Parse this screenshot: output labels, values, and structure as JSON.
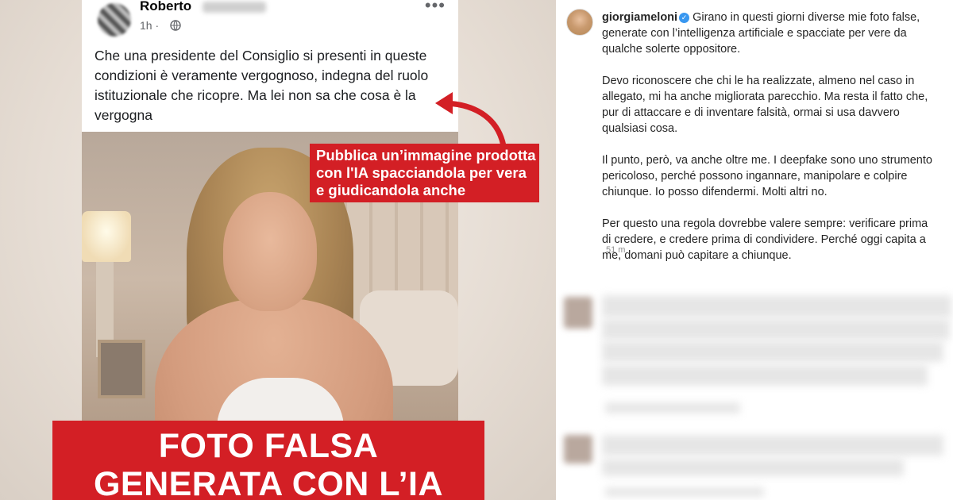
{
  "facebook_post": {
    "author": "Roberto",
    "time": "1h ·",
    "text": "Che una presidente del Consiglio  si presenti in queste condizioni è veramente vergognoso, indegna del ruolo istituzionale che ricopre. Ma lei non sa che cosa è la vergogna"
  },
  "callout": {
    "text": "Pubblica un’immagine prodotta con l'IA spacciandola per vera e giudicandola anche"
  },
  "banner": {
    "line1": "FOTO FALSA",
    "line2": "GENERATA CON L’IA"
  },
  "instagram": {
    "username": "giorgiameloni",
    "paragraphs": [
      "Girano in questi giorni diverse mie foto false, generate con l’intelligenza artificiale e spacciate per vere da qualche solerte oppositore.",
      "Devo riconoscere che chi le ha realizzate, almeno nel caso in allegato, mi ha anche migliorata parecchio. Ma resta il fatto che, pur di attaccare e di inventare falsità, ormai si usa davvero qualsiasi cosa.",
      "Il punto, però, va anche oltre me. I deepfake sono uno strumento pericoloso, perché possono ingannare, manipolare e colpire chiunque. Io posso difendermi. Molti altri no.",
      "Per questo una regola dovrebbe valere sempre: verificare prima di credere, e credere prima di condividere. Perché oggi capita a me, domani può capitare a chiunque."
    ],
    "time": "51 m"
  },
  "colors": {
    "banner_red": "#d31f25",
    "verified_blue": "#3897f0"
  },
  "icons": [
    "globe-icon",
    "more-options-icon",
    "verified-badge-icon",
    "arrow-icon"
  ]
}
